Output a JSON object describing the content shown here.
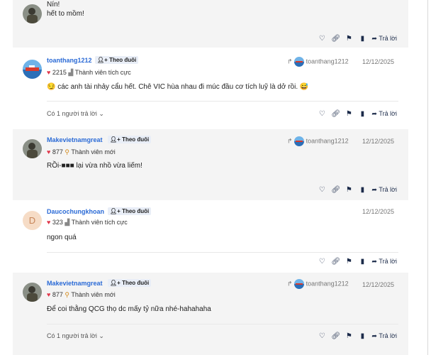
{
  "posts": [
    {
      "content_lines": [
        "Nín!",
        "hết to mồm!"
      ]
    },
    {
      "username": "toanthang1212",
      "follow_label": "Theo đuôi",
      "score": "2215",
      "rank": "Thành viên tích cực",
      "reply_to": "toanthang1212",
      "date": "12/12/2025",
      "content": "😏 các anh tài nhảy cẩu hết. Chê VIC hùa nhau đi múc đầu cơ tích luỹ là dở rồi. 😅",
      "replies_label": "Có 1 người trả lời"
    },
    {
      "username": "Makevietnamgreat",
      "follow_label": "Theo đuôi",
      "score": "877",
      "rank": "Thành viên mới",
      "reply_to": "toanthang1212",
      "date": "12/12/2025",
      "content": "RỒi-■■■ lại vừa nhồ vừa liếm!"
    },
    {
      "username": "Daucochungkhoan",
      "avatar_letter": "D",
      "follow_label": "Theo đuôi",
      "score": "323",
      "rank": "Thành viên tích cực",
      "date": "12/12/2025",
      "content": "ngon quá"
    },
    {
      "username": "Makevietnamgreat",
      "follow_label": "Theo đuôi",
      "score": "877",
      "rank": "Thành viên mới",
      "reply_to": "toanthang1212",
      "date": "12/12/2025",
      "content": "Để coi thằng QCG thọ dc mấy tỷ nữa nhé-hahahaha",
      "replies_label": "Có 1 người trả lời"
    }
  ],
  "actions": {
    "reply_label": "Trả lời"
  },
  "icons": {
    "like": "heart-outline-icon",
    "link": "link-icon",
    "report": "flag-icon",
    "bookmark": "bookmark-icon",
    "reply": "reply-arrow-icon"
  },
  "colors": {
    "username": "#2a6ad6",
    "heart": "#e0364a",
    "post_bg_gray": "#f4f4f4",
    "action_icon": "#1c2b4a"
  }
}
